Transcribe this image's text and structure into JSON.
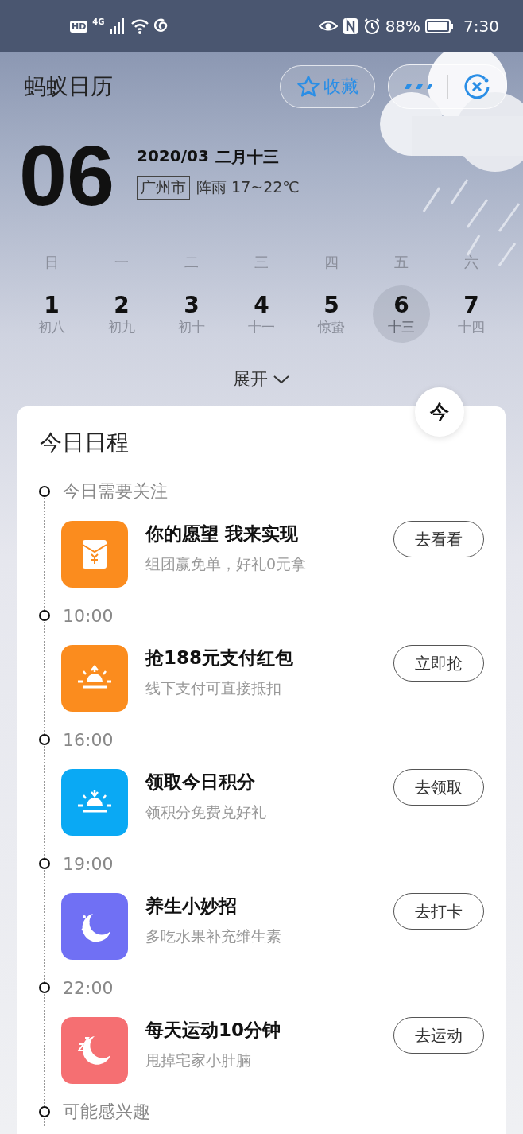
{
  "status_bar": {
    "network_badge": "HD",
    "network_type": "4G",
    "battery": "88%",
    "time": "7:30"
  },
  "header": {
    "title": "蚂蚁日历",
    "favorite_button": "收藏"
  },
  "today": {
    "day": "06",
    "date": "2020/03",
    "lunar": "二月十三",
    "city": "广州市",
    "weather": "阵雨 17~22℃"
  },
  "week": {
    "weekdays": [
      "日",
      "一",
      "二",
      "三",
      "四",
      "五",
      "六"
    ],
    "days": [
      {
        "date": "1",
        "lunar": "初八",
        "selected": false
      },
      {
        "date": "2",
        "lunar": "初九",
        "selected": false
      },
      {
        "date": "3",
        "lunar": "初十",
        "selected": false
      },
      {
        "date": "4",
        "lunar": "十一",
        "selected": false
      },
      {
        "date": "5",
        "lunar": "惊蛰",
        "selected": false
      },
      {
        "date": "6",
        "lunar": "十三",
        "selected": true
      },
      {
        "date": "7",
        "lunar": "十四",
        "selected": false
      }
    ],
    "expand_button": "展开"
  },
  "today_button": "今",
  "schedule": {
    "title": "今日日程",
    "sections": [
      {
        "label": "今日需要关注",
        "items": [
          {
            "kind": "envelope",
            "color": "#fb8c1e",
            "title": "你的愿望 我来实现",
            "subtitle": "组团赢免单，好礼0元拿",
            "action": "去看看"
          }
        ]
      },
      {
        "label": "10:00",
        "items": [
          {
            "kind": "sunrise",
            "color": "#fb8c1e",
            "title": "抢188元支付红包",
            "subtitle": "线下支付可直接抵扣",
            "action": "立即抢"
          }
        ]
      },
      {
        "label": "16:00",
        "items": [
          {
            "kind": "sunset",
            "color": "#0aa9f4",
            "title": "领取今日积分",
            "subtitle": "领积分免费兑好礼",
            "action": "去领取"
          }
        ]
      },
      {
        "label": "19:00",
        "items": [
          {
            "kind": "moon",
            "color": "#7070f4",
            "title": "养生小妙招",
            "subtitle": "多吃水果补充维生素",
            "action": "去打卡"
          }
        ]
      },
      {
        "label": "22:00",
        "items": [
          {
            "kind": "sleep",
            "color": "#f56f72",
            "title": "每天运动10分钟",
            "subtitle": "甩掉宅家小肚腩",
            "action": "去运动"
          }
        ]
      },
      {
        "label": "可能感兴趣"
      }
    ]
  }
}
